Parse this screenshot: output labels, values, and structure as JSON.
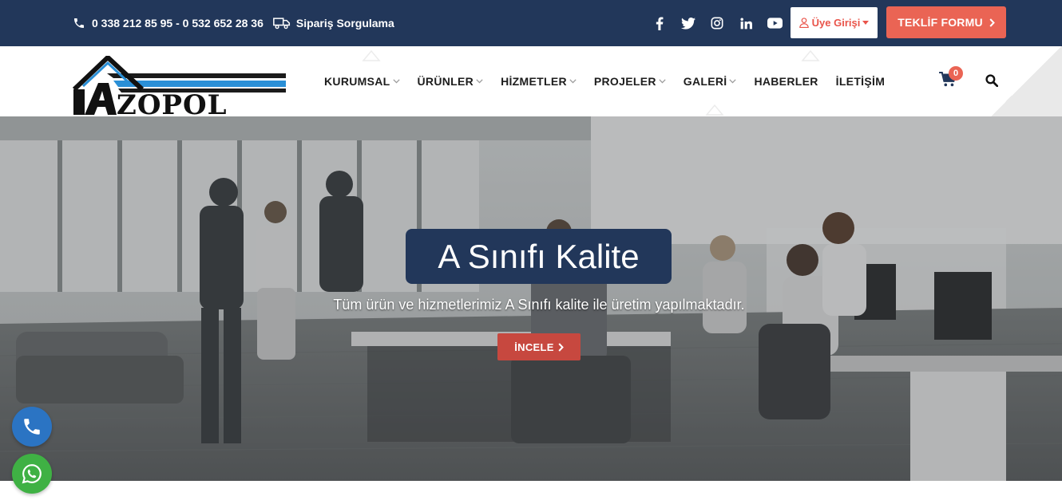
{
  "topbar": {
    "phone_icon": "phone-icon",
    "phones": "0 338 212 85 95 - 0 532 652 28 36",
    "truck_icon": "truck-icon",
    "order_query": "Sipariş Sorgulama",
    "social": [
      "facebook-icon",
      "twitter-icon",
      "instagram-icon",
      "linkedin-icon",
      "youtube-icon"
    ],
    "login_label": "Üye Girişi",
    "teklif_label": "TEKLİF FORMU"
  },
  "header": {
    "logo_text": "ZOPOL",
    "nav": [
      {
        "label": "KURUMSAL",
        "dropdown": true
      },
      {
        "label": "ÜRÜNLER",
        "dropdown": true
      },
      {
        "label": "HİZMETLER",
        "dropdown": true
      },
      {
        "label": "PROJELER",
        "dropdown": true
      },
      {
        "label": "GALERİ",
        "dropdown": true
      },
      {
        "label": "HABERLER",
        "dropdown": false
      },
      {
        "label": "İLETİŞİM",
        "dropdown": false
      }
    ],
    "cart_count": "0"
  },
  "hero": {
    "title": "A Sınıfı Kalite",
    "subtitle": "Tüm ürün ve hizmetlerimiz A Sınıfı kalite ile üretim yapılmaktadır.",
    "button_label": "İNCELE"
  },
  "colors": {
    "navy": "#22375a",
    "accent": "#ea6454",
    "phone_float": "#2b74c3",
    "whatsapp_float": "#3fb144"
  }
}
